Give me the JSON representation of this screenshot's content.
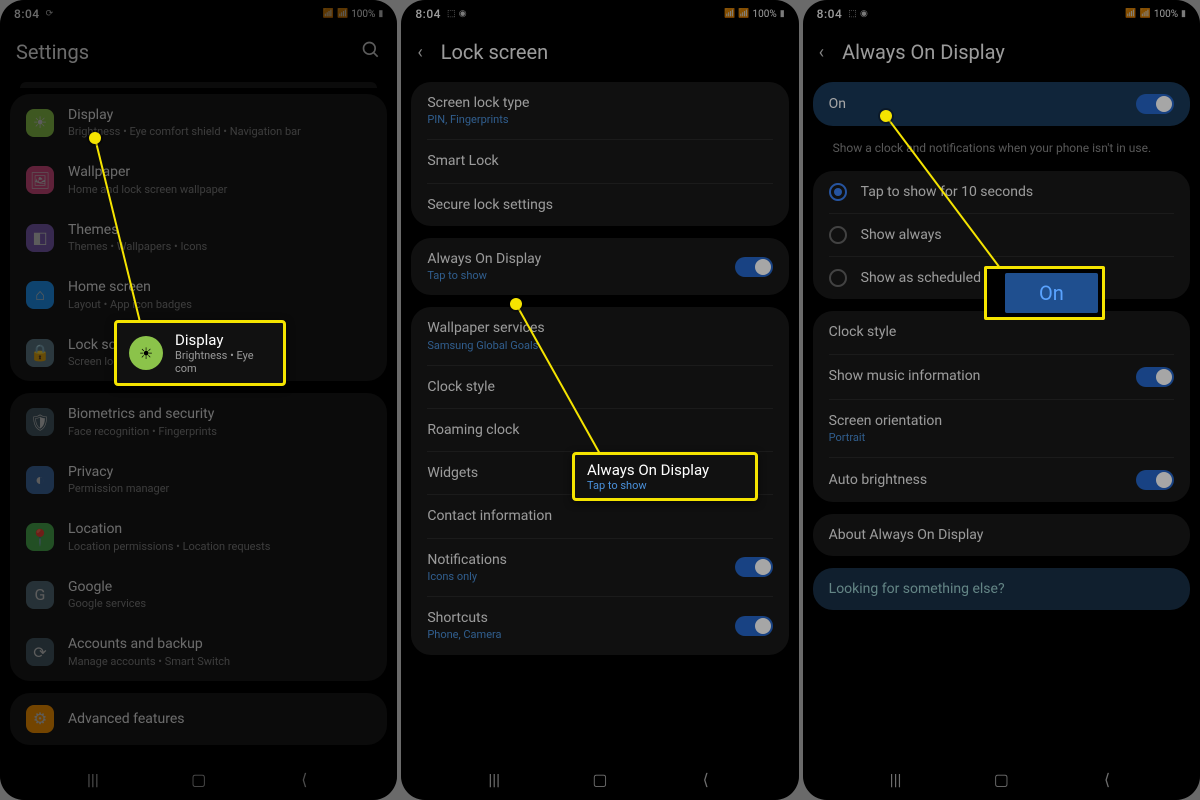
{
  "status": {
    "time": "8:04",
    "battery": "100%",
    "indicators": "⟳",
    "indicators2": "⬚ ◉"
  },
  "phone1": {
    "title": "Settings",
    "items": [
      {
        "title": "Display",
        "sub": "Brightness  •  Eye comfort shield  •  Navigation bar",
        "color": "#8bc34a"
      },
      {
        "title": "Wallpaper",
        "sub": "Home and lock screen wallpaper",
        "color": "#d24b7e"
      },
      {
        "title": "Themes",
        "sub": "Themes  •  Wallpapers  •  Icons",
        "color": "#7b5bb0"
      },
      {
        "title": "Home screen",
        "sub": "Layout  •  App icon badges",
        "color": "#2196f3"
      },
      {
        "title": "Lock screen",
        "sub": "Screen lock type  •  Always On Display",
        "color": "#607d8b"
      }
    ],
    "items2": [
      {
        "title": "Biometrics and security",
        "sub": "Face recognition  •  Fingerprints",
        "color": "#455a64"
      },
      {
        "title": "Privacy",
        "sub": "Permission manager",
        "color": "#3f6aa3"
      },
      {
        "title": "Location",
        "sub": "Location permissions  •  Location requests",
        "color": "#4caf50"
      },
      {
        "title": "Google",
        "sub": "Google services",
        "color": "#546e7a"
      },
      {
        "title": "Accounts and backup",
        "sub": "Manage accounts  •  Smart Switch",
        "color": "#455a64"
      }
    ],
    "items3": [
      {
        "title": "Advanced features",
        "sub": "",
        "color": "#ff9800"
      }
    ]
  },
  "phone2": {
    "title": "Lock screen",
    "g1": [
      {
        "title": "Screen lock type",
        "sub": "PIN, Fingerprints",
        "subBlue": true
      },
      {
        "title": "Smart Lock"
      },
      {
        "title": "Secure lock settings"
      }
    ],
    "g2": [
      {
        "title": "Always On Display",
        "sub": "Tap to show",
        "subBlue": true,
        "toggle": true
      }
    ],
    "g3": [
      {
        "title": "Wallpaper services",
        "sub": "Samsung Global Goals",
        "subBlue": true
      },
      {
        "title": "Clock style"
      },
      {
        "title": "Roaming clock"
      },
      {
        "title": "Widgets"
      },
      {
        "title": "Contact information"
      },
      {
        "title": "Notifications",
        "sub": "Icons only",
        "subBlue": true,
        "toggle": true
      },
      {
        "title": "Shortcuts",
        "sub": "Phone, Camera",
        "subBlue": true,
        "toggle": true
      }
    ]
  },
  "phone3": {
    "title": "Always On Display",
    "onLabel": "On",
    "desc": "Show a clock and notifications when your phone isn't in use.",
    "radios": [
      {
        "label": "Tap to show for 10 seconds",
        "selected": true
      },
      {
        "label": "Show always",
        "selected": false
      },
      {
        "label": "Show as scheduled",
        "selected": false
      }
    ],
    "g2": [
      {
        "title": "Clock style"
      },
      {
        "title": "Show music information",
        "toggle": true
      },
      {
        "title": "Screen orientation",
        "sub": "Portrait",
        "subBlue": true
      },
      {
        "title": "Auto brightness",
        "toggle": true
      }
    ],
    "g3": [
      {
        "title": "About Always On Display"
      }
    ],
    "footer": "Looking for something else?"
  },
  "callout1": {
    "title": "Display",
    "sub": "Brightness  •  Eye com"
  },
  "callout2": {
    "title": "Always On Display",
    "sub": "Tap to show"
  },
  "callout3": {
    "label": "On"
  }
}
